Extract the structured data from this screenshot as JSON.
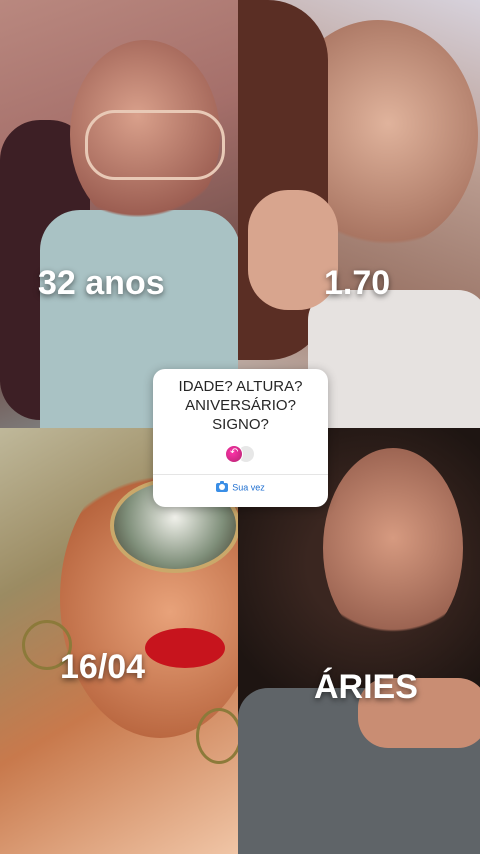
{
  "labels": {
    "age": "32 anos",
    "height": "1.70",
    "birthday": "16/04",
    "sign": "ÁRIES"
  },
  "question_card": {
    "line1": "IDADE? ALTURA?",
    "line2": "ANIVERSÁRIO?",
    "line3": "SIGNO?",
    "cta_label": "Sua vez",
    "cta_icon": "camera-icon",
    "accent_color": "#1f6fd0"
  }
}
